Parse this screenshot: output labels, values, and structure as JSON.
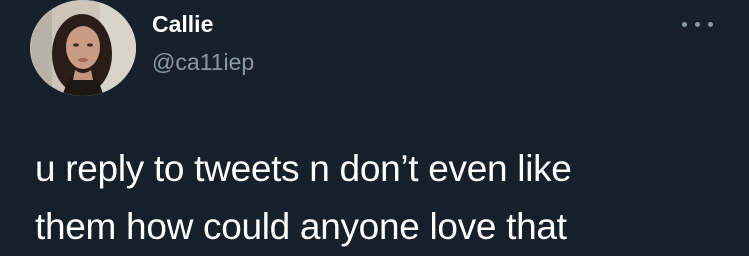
{
  "background": "#15202b",
  "author": {
    "display_name": "Callie",
    "handle": "@ca11iep",
    "avatar": "profile-photo"
  },
  "menu": {
    "icon": "more-options-icon"
  },
  "tweet": {
    "lines": [
      "u reply to tweets n don’t even like",
      "them how could anyone love that"
    ]
  },
  "colors": {
    "primary_text": "#ffffff",
    "secondary_text": "#8899a6"
  }
}
